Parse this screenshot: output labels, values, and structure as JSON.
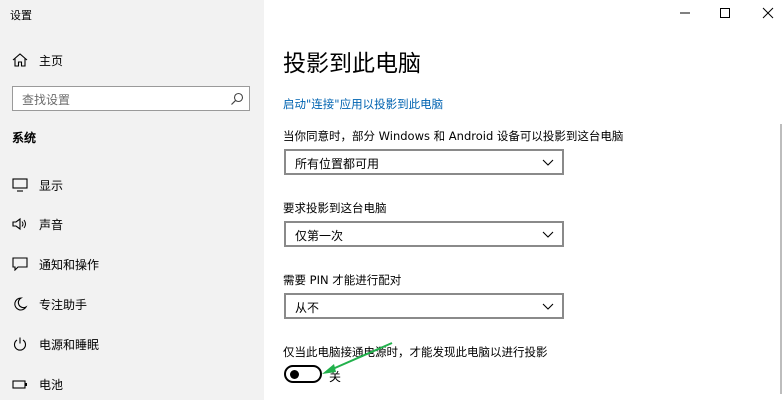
{
  "window": {
    "title": "设置",
    "controls": {
      "minimize_icon": "minimize-icon",
      "maximize_icon": "maximize-icon",
      "close_icon": "close-icon"
    }
  },
  "sidebar": {
    "home_label": "主页",
    "search": {
      "placeholder": "查找设置",
      "icon": "search-icon"
    },
    "section_title": "系统",
    "items": [
      {
        "label": "显示",
        "icon": "monitor-icon"
      },
      {
        "label": "声音",
        "icon": "speaker-icon"
      },
      {
        "label": "通知和操作",
        "icon": "notification-icon"
      },
      {
        "label": "专注助手",
        "icon": "moon-icon"
      },
      {
        "label": "电源和睡眠",
        "icon": "power-icon"
      },
      {
        "label": "电池",
        "icon": "battery-icon"
      }
    ]
  },
  "main": {
    "title": "投影到此电脑",
    "link_text": "启动\"连接\"应用以投影到此电脑",
    "settings": [
      {
        "label": "当你同意时，部分 Windows 和 Android 设备可以投影到这台电脑",
        "value": "所有位置都可用"
      },
      {
        "label": "要求投影到这台电脑",
        "value": "仅第一次"
      },
      {
        "label": "需要 PIN 才能进行配对",
        "value": "从不"
      }
    ],
    "power_toggle": {
      "label": "仅当此电脑接通电源时，才能发现此电脑以进行投影",
      "state_text": "关",
      "on": false
    }
  },
  "colors": {
    "link": "#0063b1",
    "sidebar_bg": "#f2f2f2",
    "annotation_arrow": "#22b14c"
  }
}
